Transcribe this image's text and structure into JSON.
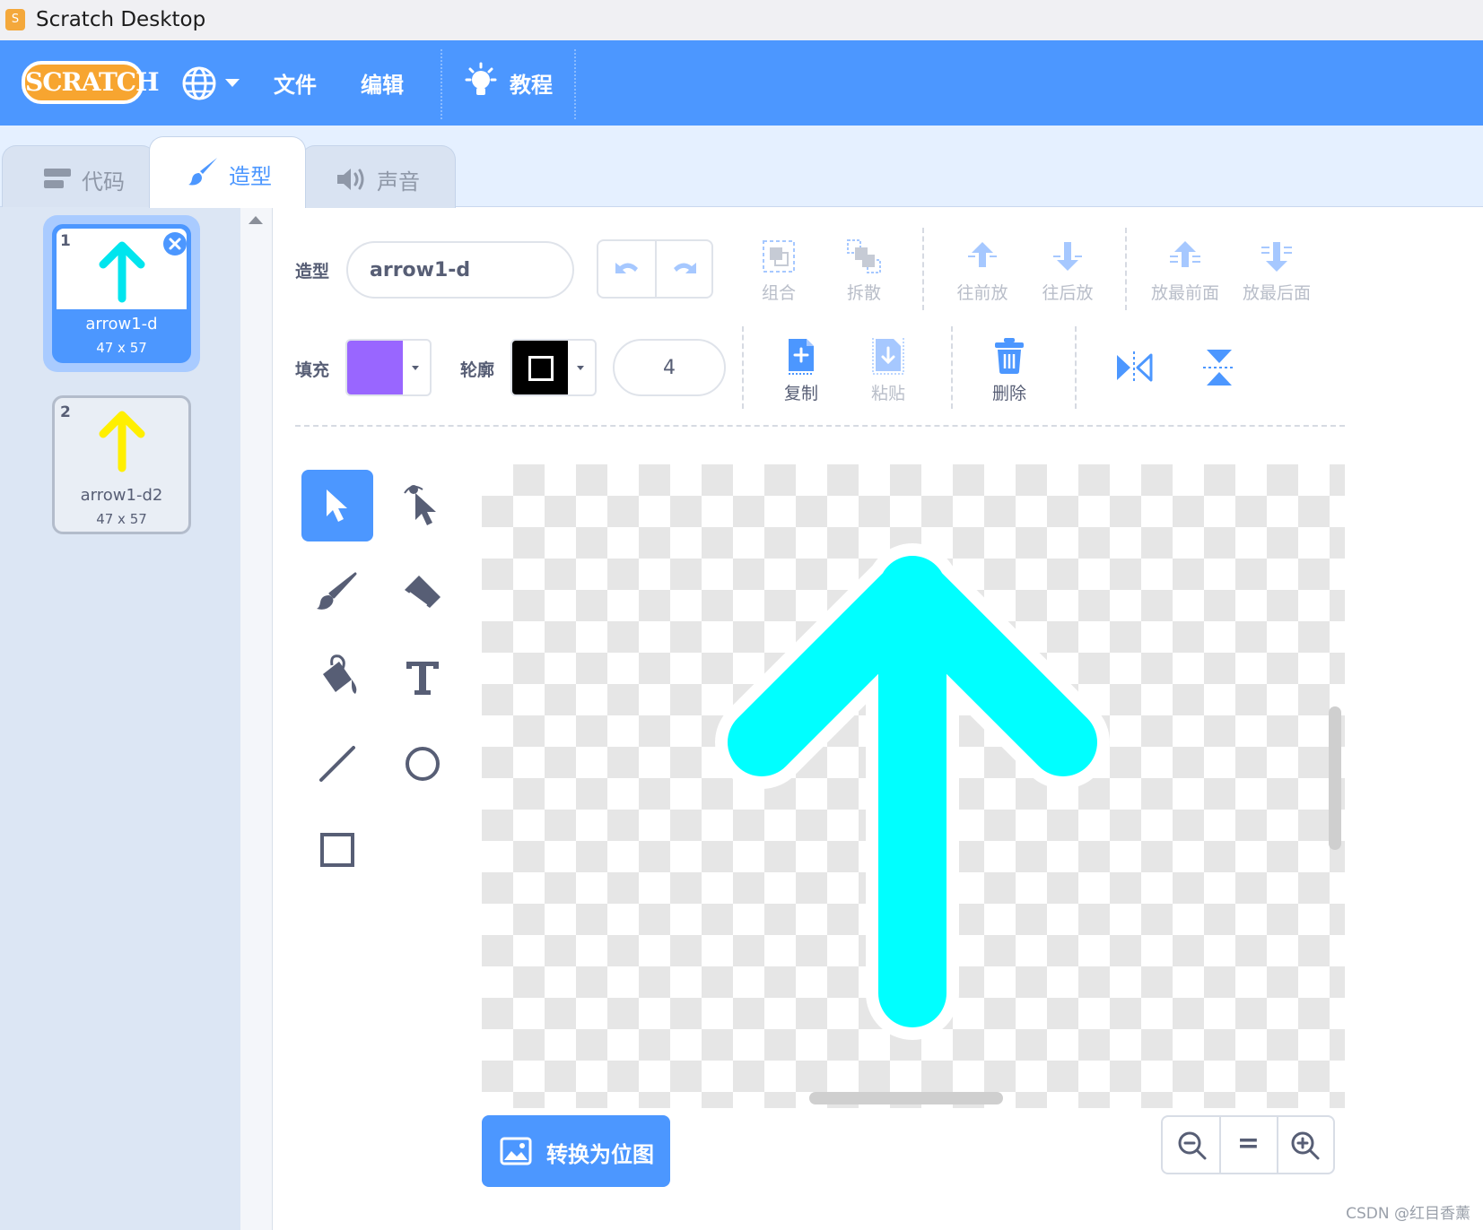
{
  "window": {
    "title": "Scratch Desktop",
    "app_icon": "scratch-app-icon"
  },
  "menubar": {
    "logo_text": "SCRATCH",
    "globe_icon": "globe-icon",
    "file": "文件",
    "edit": "编辑",
    "tutorials": "教程",
    "accent_color": "#4c97ff"
  },
  "tabs": [
    {
      "id": "code",
      "label": "代码",
      "icon": "code-blocks-icon",
      "active": false
    },
    {
      "id": "costumes",
      "label": "造型",
      "icon": "paintbrush-icon",
      "active": true
    },
    {
      "id": "sounds",
      "label": "声音",
      "icon": "speaker-icon",
      "active": false
    }
  ],
  "costumes": [
    {
      "index": "1",
      "name": "arrow1-d",
      "size": "47 x 57",
      "color": "#00e5ee",
      "selected": true
    },
    {
      "index": "2",
      "name": "arrow1-d2",
      "size": "47 x 57",
      "color": "#ffef00",
      "selected": false
    }
  ],
  "editor": {
    "costume_label": "造型",
    "costume_name": "arrow1-d",
    "fill_label": "填充",
    "fill_color": "#9966ff",
    "outline_label": "轮廓",
    "outline_color": "#000000",
    "outline_width": "4",
    "actions": {
      "group": "组合",
      "ungroup": "拆散",
      "forward": "往前放",
      "backward": "往后放",
      "front": "放最前面",
      "back": "放最后面",
      "copy": "复制",
      "paste": "粘贴",
      "delete": "删除"
    },
    "convert_button": "转换为位图",
    "zoom_reset": "="
  },
  "canvas": {
    "arrow_color": "#00ffff"
  },
  "watermark": "CSDN @红目香薰"
}
